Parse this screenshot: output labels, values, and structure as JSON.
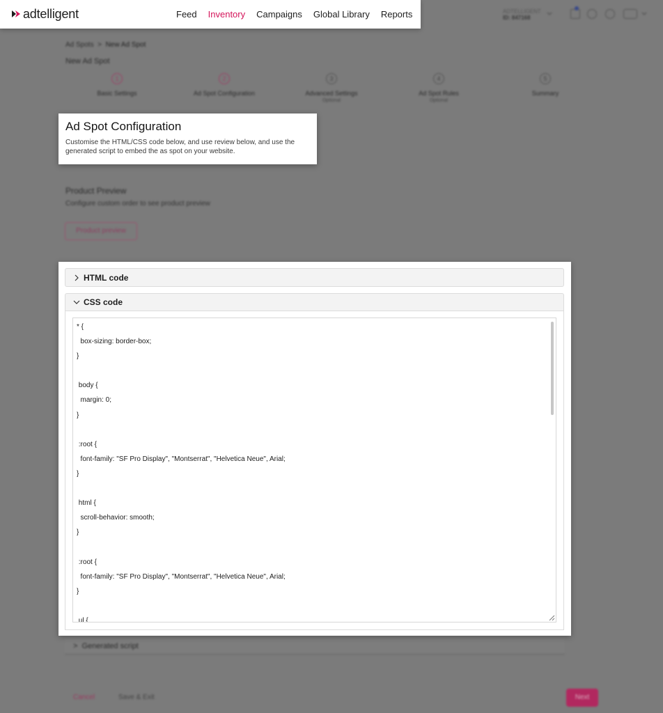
{
  "app": {
    "logo_text": "adtelligent"
  },
  "nav": {
    "items": [
      {
        "label": "Feed",
        "active": false
      },
      {
        "label": "Inventory",
        "active": true
      },
      {
        "label": "Campaigns",
        "active": false
      },
      {
        "label": "Global Library",
        "active": false
      },
      {
        "label": "Reports",
        "active": false
      }
    ]
  },
  "background": {
    "breadcrumb": [
      "Ad Spots",
      ">",
      "New Ad Spot"
    ],
    "page_title": "New Ad Spot",
    "steps": [
      {
        "number": "1",
        "label": "Basic Settings",
        "sub": ""
      },
      {
        "number": "2",
        "label": "Ad Spot Configuration",
        "sub": ""
      },
      {
        "number": "3",
        "label": "Advanced Settings",
        "sub": "Optional"
      },
      {
        "number": "4",
        "label": "Ad Spot Rules",
        "sub": "Optional"
      },
      {
        "number": "5",
        "label": "Summary",
        "sub": ""
      }
    ],
    "product_preview": {
      "title": "Product Preview",
      "subtitle": "Configure custom order to see product preview",
      "button": "Product preview"
    },
    "generated_script": "Generated script",
    "footer": {
      "cancel": "Cancel",
      "save_draft": "Save & Exit",
      "next": "Next"
    },
    "user": {
      "line1": "ADTELLIGENT",
      "line2": "ID: 847168"
    }
  },
  "callout": {
    "title": "Ad Spot Configuration",
    "description": "Customise the HTML/CSS code below, and use review below, and use the generated script to embed the as spot on your website."
  },
  "html_section": {
    "label": "HTML code",
    "expanded": false
  },
  "css_section": {
    "label": "CSS code",
    "expanded": true,
    "code": "* {\n  box-sizing: border-box;\n}\n\n body {\n  margin: 0;\n}\n\n :root {\n  font-family: \"SF Pro Display\", \"Montserrat\", \"Helvetica Neue\", Arial;\n}\n\n html {\n  scroll-behavior: smooth;\n}\n\n :root {\n  font-family: \"SF Pro Display\", \"Montserrat\", \"Helvetica Neue\", Arial;\n}\n\n ul {"
  },
  "colors": {
    "accent": "#d4145a",
    "overlay": "#7b7b7b"
  }
}
